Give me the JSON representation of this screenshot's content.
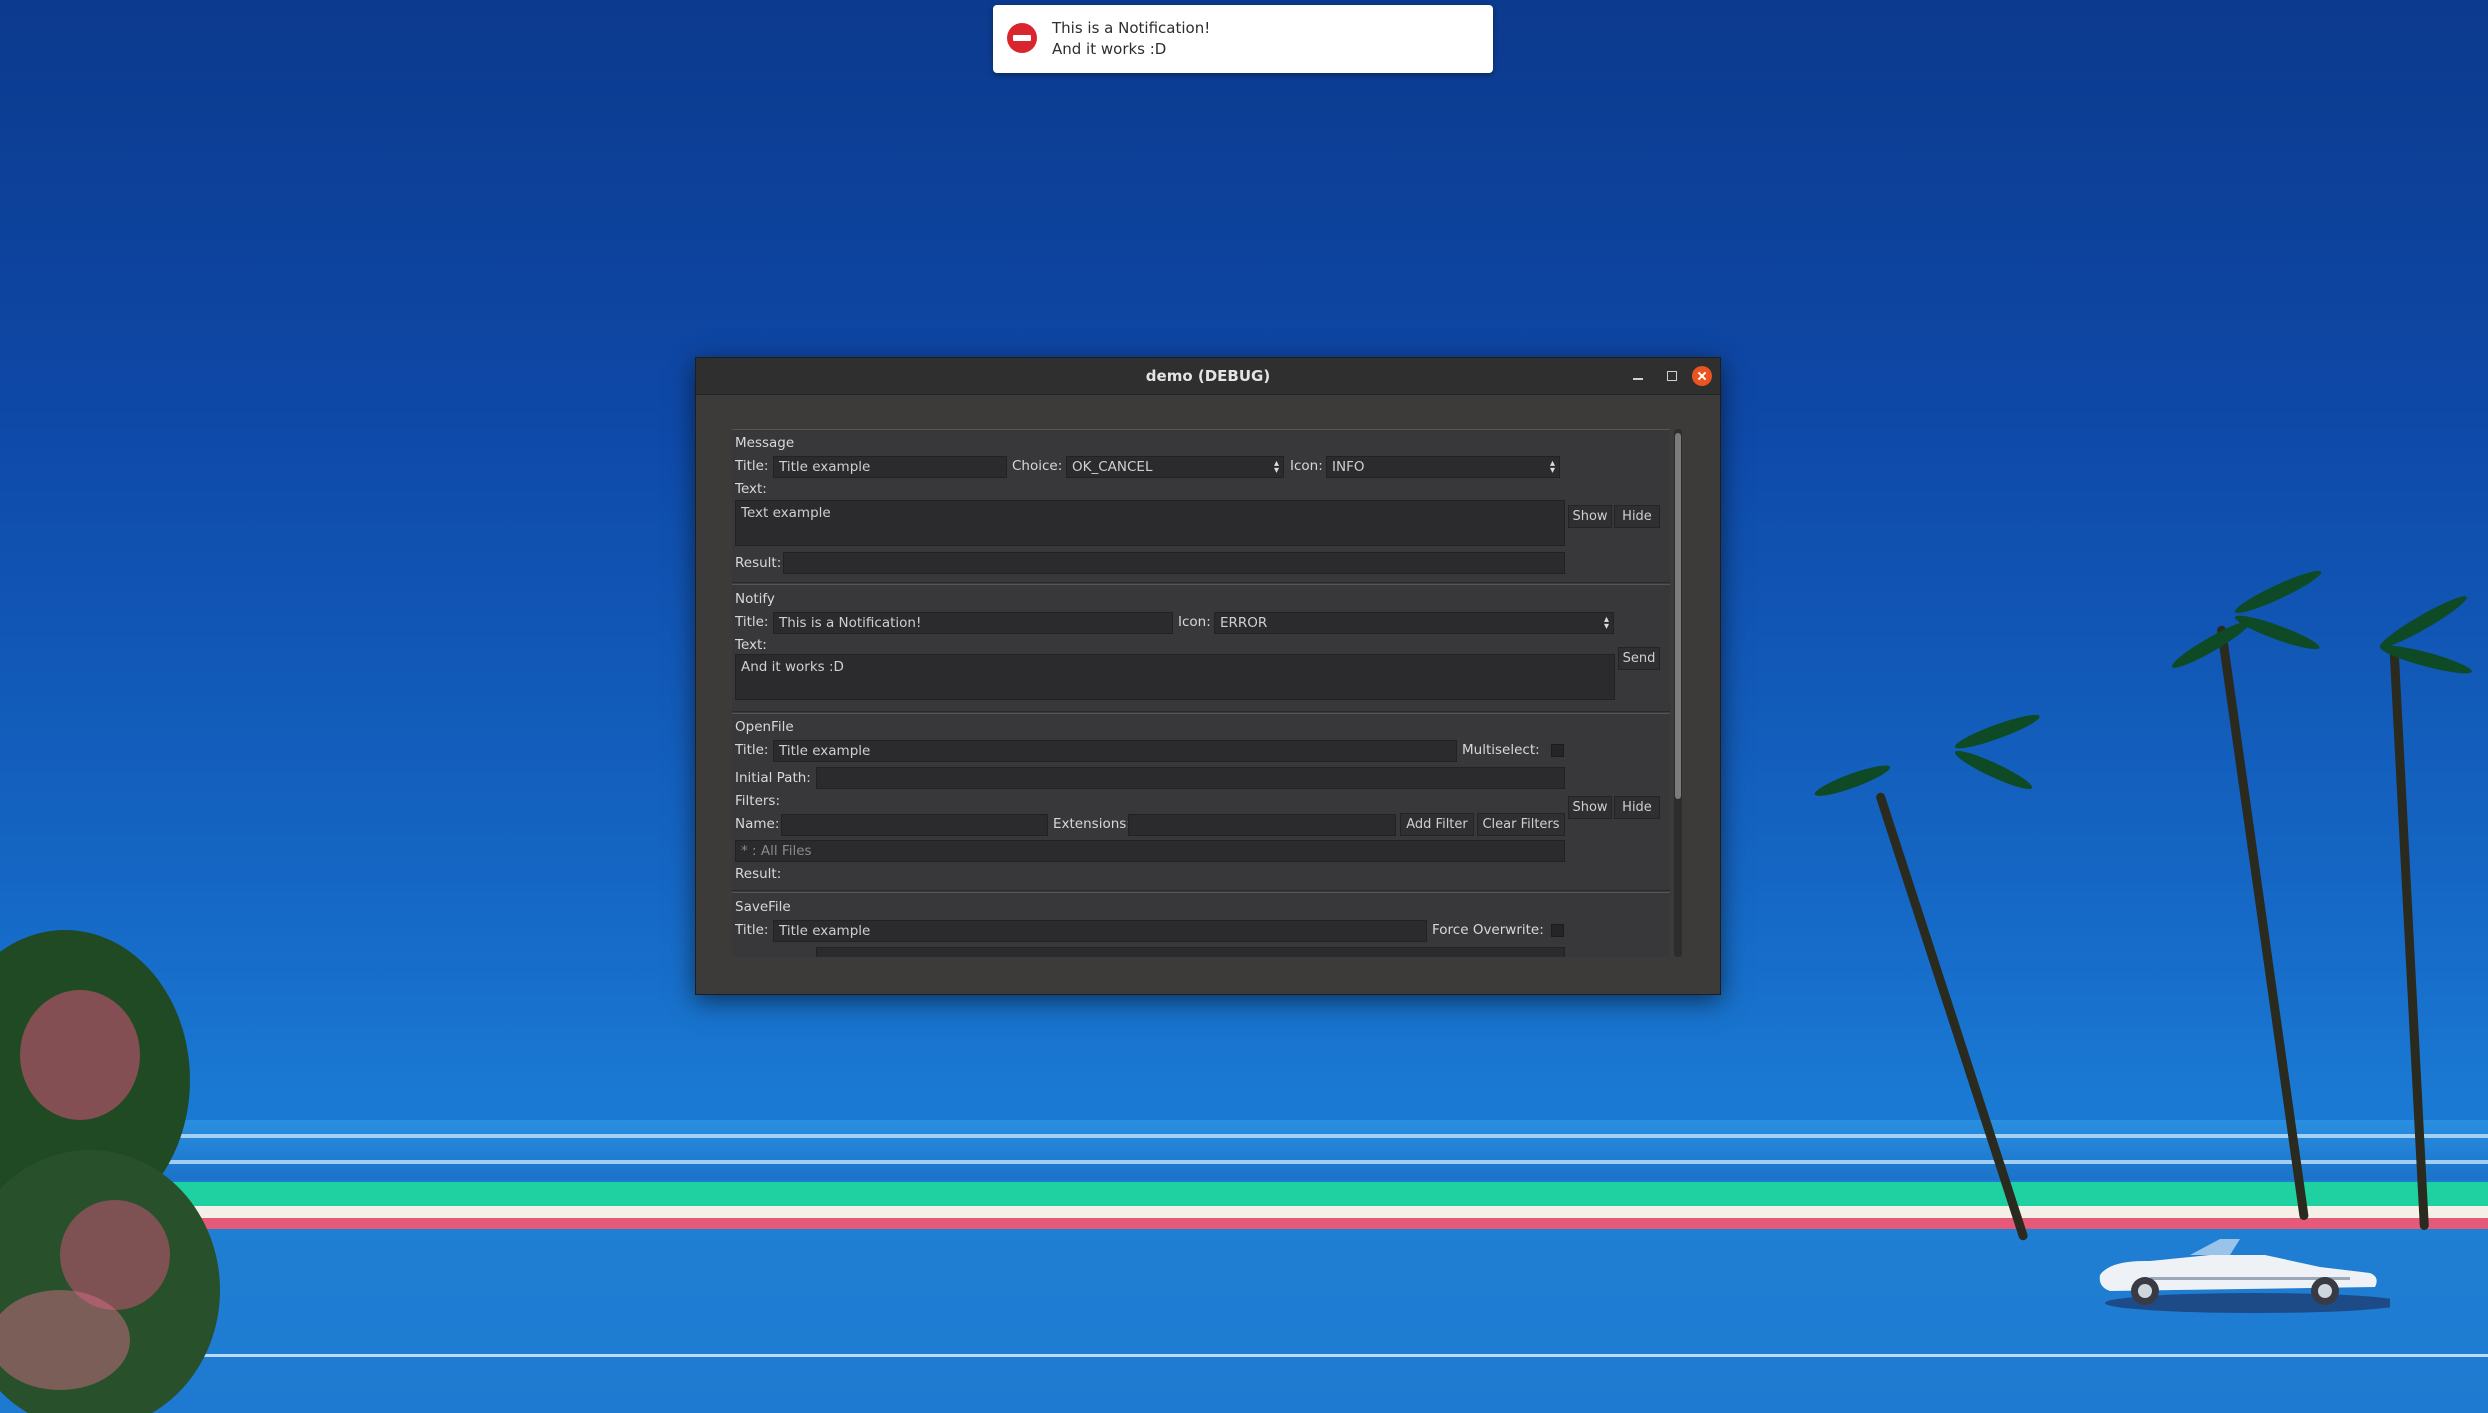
{
  "window": {
    "title": "demo (DEBUG)"
  },
  "notification": {
    "title": "This is a Notification!",
    "text": "And it works :D"
  },
  "message": {
    "heading": "Message",
    "title_label": "Title:",
    "title_value": "Title example",
    "choice_label": "Choice:",
    "choice_value": "OK_CANCEL",
    "icon_label": "Icon:",
    "icon_value": "INFO",
    "text_label": "Text:",
    "text_value": "Text example",
    "result_label": "Result:",
    "result_value": "",
    "show_label": "Show",
    "hide_label": "Hide"
  },
  "notify": {
    "heading": "Notify",
    "title_label": "Title:",
    "title_value": "This is a Notification!",
    "icon_label": "Icon:",
    "icon_value": "ERROR",
    "text_label": "Text:",
    "text_value": "And it works :D",
    "send_label": "Send"
  },
  "openfile": {
    "heading": "OpenFile",
    "title_label": "Title:",
    "title_value": "Title example",
    "multiselect_label": "Multiselect:",
    "initial_path_label": "Initial Path:",
    "initial_path_value": "",
    "filters_label": "Filters:",
    "name_label": "Name:",
    "name_value": "",
    "extensions_label": "Extensions:",
    "extensions_value": "",
    "add_filter_label": "Add Filter",
    "clear_filters_label": "Clear Filters",
    "filter_list_item": "* : All Files",
    "result_label": "Result:",
    "show_label": "Show",
    "hide_label": "Hide"
  },
  "savefile": {
    "heading": "SaveFile",
    "title_label": "Title:",
    "title_value": "Title example",
    "force_overwrite_label": "Force Overwrite:"
  },
  "colors": {
    "window_bg": "#3c3b3a",
    "titlebar": "#2f2f2f",
    "close_button": "#e95420",
    "notification_error": "#d9262e"
  },
  "icons": {
    "notification": "error-icon",
    "minimize": "minimize-icon",
    "maximize": "maximize-icon",
    "close": "close-icon",
    "combo": "updown-arrows-icon"
  }
}
